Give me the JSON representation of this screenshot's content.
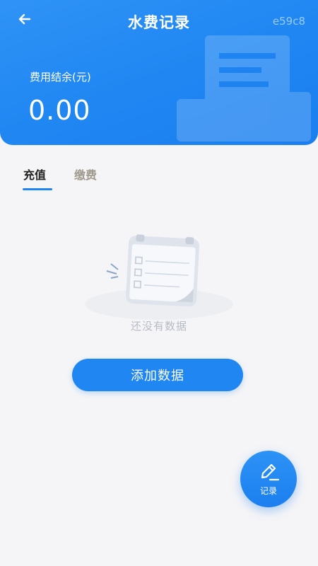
{
  "header": {
    "title": "水费记录",
    "hex_code": "e59c8",
    "balance_label": "费用结余(元)",
    "balance_value": "0.00",
    "back_icon": "arrow-left-icon"
  },
  "tabs": [
    {
      "label": "充值",
      "active": true
    },
    {
      "label": "缴费",
      "active": false
    }
  ],
  "empty_state": {
    "icon": "empty-notebook-icon",
    "text": "还没有数据"
  },
  "actions": {
    "add_label": "添加数据",
    "fab_label": "记录",
    "fab_icon": "edit-pen-icon"
  },
  "colors": {
    "primary": "#1f86f2",
    "tab_active": "#222222",
    "tab_inactive": "#a09a8e",
    "empty_text": "#b6bbc4"
  }
}
